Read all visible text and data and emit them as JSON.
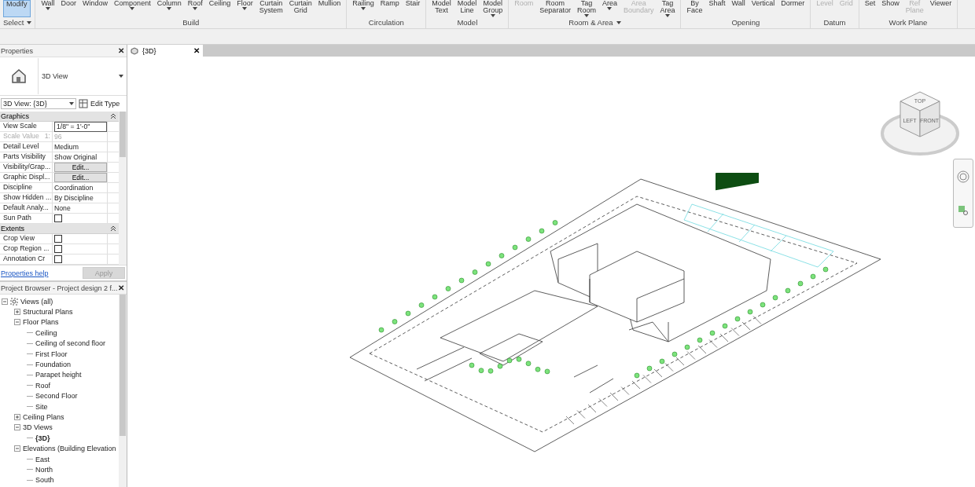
{
  "ribbon": {
    "groups": [
      {
        "title": "Select",
        "caret": true,
        "buttons": [
          {
            "label": "Modify",
            "caret": false,
            "disabled": false,
            "selected": true
          }
        ]
      },
      {
        "title": "Build",
        "caret": false,
        "buttons": [
          {
            "label": "Wall",
            "caret": true,
            "disabled": false,
            "selected": false
          },
          {
            "label": "Door",
            "caret": false,
            "disabled": false,
            "selected": false
          },
          {
            "label": "Window",
            "caret": false,
            "disabled": false,
            "selected": false
          },
          {
            "label": "Component",
            "caret": true,
            "disabled": false,
            "selected": false
          },
          {
            "label": "Column",
            "caret": true,
            "disabled": false,
            "selected": false
          },
          {
            "label": "Roof",
            "caret": true,
            "disabled": false,
            "selected": false
          },
          {
            "label": "Ceiling",
            "caret": false,
            "disabled": false,
            "selected": false
          },
          {
            "label": "Floor",
            "caret": true,
            "disabled": false,
            "selected": false
          },
          {
            "label": "Curtain\nSystem",
            "caret": false,
            "disabled": false,
            "selected": false
          },
          {
            "label": "Curtain\nGrid",
            "caret": false,
            "disabled": false,
            "selected": false
          },
          {
            "label": "Mullion",
            "caret": false,
            "disabled": false,
            "selected": false
          }
        ]
      },
      {
        "title": "Circulation",
        "caret": false,
        "buttons": [
          {
            "label": "Railing",
            "caret": true,
            "disabled": false,
            "selected": false
          },
          {
            "label": "Ramp",
            "caret": false,
            "disabled": false,
            "selected": false
          },
          {
            "label": "Stair",
            "caret": false,
            "disabled": false,
            "selected": false
          }
        ]
      },
      {
        "title": "Model",
        "caret": false,
        "buttons": [
          {
            "label": "Model\nText",
            "caret": false,
            "disabled": false,
            "selected": false
          },
          {
            "label": "Model\nLine",
            "caret": false,
            "disabled": false,
            "selected": false
          },
          {
            "label": "Model\nGroup",
            "caret": true,
            "disabled": false,
            "selected": false
          }
        ]
      },
      {
        "title": "Room & Area",
        "caret": true,
        "buttons": [
          {
            "label": "Room",
            "caret": false,
            "disabled": true,
            "selected": false
          },
          {
            "label": "Room\nSeparator",
            "caret": false,
            "disabled": false,
            "selected": false
          },
          {
            "label": "Tag\nRoom",
            "caret": true,
            "disabled": false,
            "selected": false
          },
          {
            "label": "Area",
            "caret": true,
            "disabled": false,
            "selected": false
          },
          {
            "label": "Area\nBoundary",
            "caret": false,
            "disabled": true,
            "selected": false
          },
          {
            "label": "Tag\nArea",
            "caret": true,
            "disabled": false,
            "selected": false
          }
        ]
      },
      {
        "title": "Opening",
        "caret": false,
        "buttons": [
          {
            "label": "By\nFace",
            "caret": false,
            "disabled": false,
            "selected": false
          },
          {
            "label": "Shaft",
            "caret": false,
            "disabled": false,
            "selected": false
          },
          {
            "label": "Wall",
            "caret": false,
            "disabled": false,
            "selected": false
          },
          {
            "label": "Vertical",
            "caret": false,
            "disabled": false,
            "selected": false
          },
          {
            "label": "Dormer",
            "caret": false,
            "disabled": false,
            "selected": false
          }
        ]
      },
      {
        "title": "Datum",
        "caret": false,
        "buttons": [
          {
            "label": "Level",
            "caret": false,
            "disabled": true,
            "selected": false
          },
          {
            "label": "Grid",
            "caret": false,
            "disabled": true,
            "selected": false
          }
        ]
      },
      {
        "title": "Work Plane",
        "caret": false,
        "buttons": [
          {
            "label": "Set",
            "caret": false,
            "disabled": false,
            "selected": false
          },
          {
            "label": "Show",
            "caret": false,
            "disabled": false,
            "selected": false
          },
          {
            "label": "Ref\nPlane",
            "caret": false,
            "disabled": true,
            "selected": false
          },
          {
            "label": "Viewer",
            "caret": false,
            "disabled": false,
            "selected": false
          }
        ]
      }
    ]
  },
  "properties": {
    "title": "Properties",
    "close": "✕",
    "type_name": "3D View",
    "selector": "3D View: {3D}",
    "edit_type": "Edit Type",
    "sections": [
      {
        "title": "Graphics",
        "rows": [
          {
            "name": "View Scale",
            "kind": "input",
            "value": "1/8\" = 1'-0\"",
            "disabled": false
          },
          {
            "name": "Scale Value",
            "prefix": "1:",
            "kind": "text",
            "value": "96",
            "disabled": true
          },
          {
            "name": "Detail Level",
            "kind": "text",
            "value": "Medium",
            "disabled": false
          },
          {
            "name": "Parts Visibility",
            "kind": "text",
            "value": "Show Original",
            "disabled": false
          },
          {
            "name": "Visibility/Grap...",
            "kind": "button",
            "value": "Edit...",
            "disabled": false
          },
          {
            "name": "Graphic Displ...",
            "kind": "button",
            "value": "Edit...",
            "disabled": false
          },
          {
            "name": "Discipline",
            "kind": "text",
            "value": "Coordination",
            "disabled": false
          },
          {
            "name": "Show Hidden ...",
            "kind": "text",
            "value": "By Discipline",
            "disabled": false
          },
          {
            "name": "Default Analy...",
            "kind": "text",
            "value": "None",
            "disabled": false
          },
          {
            "name": "Sun Path",
            "kind": "checkbox",
            "checked": false,
            "disabled": false
          }
        ]
      },
      {
        "title": "Extents",
        "rows": [
          {
            "name": "Crop View",
            "kind": "checkbox",
            "checked": false,
            "disabled": false
          },
          {
            "name": "Crop Region ...",
            "kind": "checkbox",
            "checked": false,
            "disabled": false
          },
          {
            "name": "Annotation Cr",
            "kind": "checkbox",
            "checked": false,
            "disabled": false
          }
        ]
      }
    ],
    "help_link": "Properties help",
    "apply": "Apply"
  },
  "project_browser": {
    "title": "Project Browser - Project design 2 f...",
    "close": "✕",
    "tree": [
      {
        "label": "Views (all)",
        "expanded": true,
        "children": [
          {
            "label": "Structural Plans",
            "expanded": false
          },
          {
            "label": "Floor Plans",
            "expanded": true,
            "children": [
              {
                "label": "Ceiling"
              },
              {
                "label": "Ceiling of second floor"
              },
              {
                "label": "First Floor"
              },
              {
                "label": "Foundation"
              },
              {
                "label": "Parapet height"
              },
              {
                "label": "Roof"
              },
              {
                "label": "Second Floor"
              },
              {
                "label": "Site"
              }
            ]
          },
          {
            "label": "Ceiling Plans",
            "expanded": false
          },
          {
            "label": "3D Views",
            "expanded": true,
            "children": [
              {
                "label": "{3D}",
                "selected": true
              }
            ]
          },
          {
            "label": "Elevations (Building Elevation",
            "expanded": true,
            "children": [
              {
                "label": "East"
              },
              {
                "label": "North"
              },
              {
                "label": "South"
              }
            ]
          }
        ]
      }
    ]
  },
  "view_tab": {
    "label": "{3D}",
    "close": "✕"
  },
  "view_cube": {
    "top": "TOP",
    "left": "LEFT",
    "front": "FRONT"
  }
}
